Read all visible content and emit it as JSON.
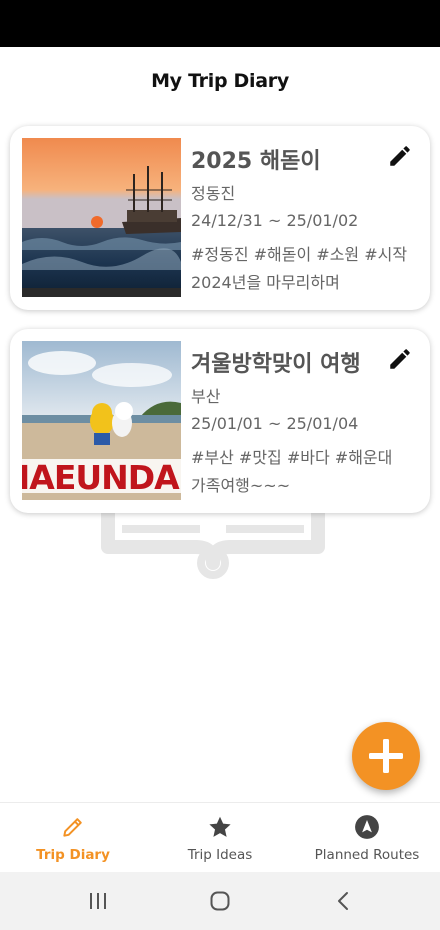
{
  "app": {
    "title": "My Trip Diary"
  },
  "diaries": [
    {
      "title": "2025 해돋이",
      "location": "정동진",
      "dates": "24/12/31 ~ 25/01/02",
      "tags": "#정동진 #해돋이 #소원 #시작",
      "memo": "2024년을 마무리하며",
      "photo": "sunrise-ship-sea"
    },
    {
      "title": "겨울방학맞이 여행",
      "location": "부산",
      "dates": "25/01/01 ~ 25/01/04",
      "tags": "#부산 #맛집 #바다 #해운대",
      "memo": "가족여행~~~",
      "photo": "haeundae-beach-sign"
    }
  ],
  "fab": {
    "icon": "plus-icon"
  },
  "bottom_nav": {
    "items": [
      {
        "label": "Trip Diary",
        "icon": "pencil-icon",
        "active": true
      },
      {
        "label": "Trip Ideas",
        "icon": "star-icon",
        "active": false
      },
      {
        "label": "Planned Routes",
        "icon": "navigation-icon",
        "active": false
      }
    ]
  },
  "system_nav": {
    "icons": [
      "recents-icon",
      "home-icon",
      "back-icon"
    ]
  },
  "colors": {
    "accent": "#f39224",
    "title_text": "#555555",
    "body_text": "#666666",
    "inactive_nav": "#555555"
  }
}
